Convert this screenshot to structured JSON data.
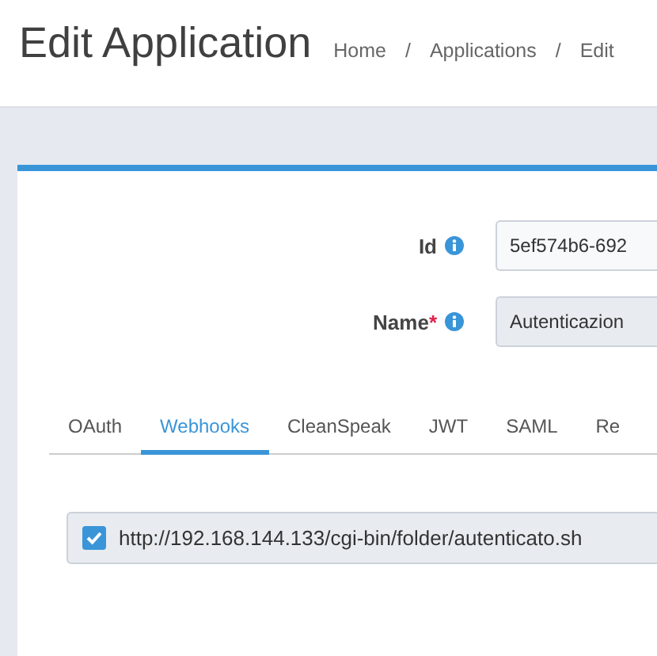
{
  "header": {
    "title": "Edit Application",
    "breadcrumbs": [
      {
        "label": "Home"
      },
      {
        "label": "Applications"
      },
      {
        "label": "Edit"
      }
    ],
    "separator": "/"
  },
  "form": {
    "fields": [
      {
        "label": "Id",
        "value": "5ef574b6-692"
      },
      {
        "label": "Name",
        "required_mark": "*",
        "value": "Autenticazion"
      }
    ]
  },
  "tabs": [
    {
      "label": "OAuth",
      "selected": false
    },
    {
      "label": "Webhooks",
      "selected": true
    },
    {
      "label": "CleanSpeak",
      "selected": false
    },
    {
      "label": "JWT",
      "selected": false
    },
    {
      "label": "SAML",
      "selected": false
    },
    {
      "label": "Re",
      "selected": false
    }
  ],
  "webhooks": [
    {
      "url": "http://192.168.144.133/cgi-bin/folder/autenticato.sh",
      "checked": true
    }
  ]
}
